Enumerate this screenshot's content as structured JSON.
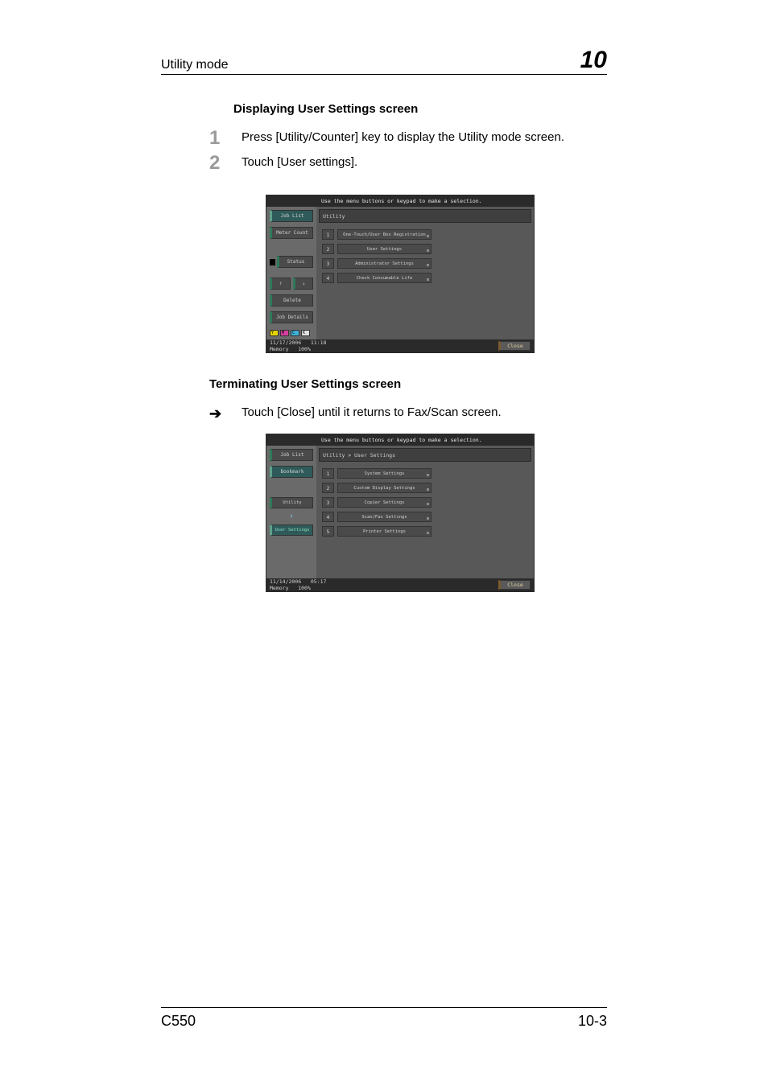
{
  "header": {
    "title": "Utility mode",
    "chapter": "10"
  },
  "sec1": {
    "heading": "Displaying User Settings screen",
    "steps": [
      "Press [Utility/Counter] key to display the Utility mode screen.",
      "Touch [User settings]."
    ]
  },
  "sec2": {
    "heading": "Terminating User Settings screen",
    "arrow_text": "Touch [Close] until it returns to Fax/Scan screen."
  },
  "shot1": {
    "top": "Use the menu buttons or keypad to make a selection.",
    "side": {
      "job_list": "Job List",
      "meter_count": "Meter Count",
      "status_lbl": "Status",
      "delete": "Delete",
      "job_details": "Job Details",
      "arrow_up": "↑",
      "arrow_down": "↓"
    },
    "crumb": "Utility",
    "menu": [
      {
        "n": "1",
        "label": "One-Touch/User Box\nRegistration"
      },
      {
        "n": "2",
        "label": "User Settings"
      },
      {
        "n": "3",
        "label": "Administrator Settings"
      },
      {
        "n": "4",
        "label": "Check Consumable Life"
      }
    ],
    "foot": {
      "date": "11/17/2006",
      "time": "11:18",
      "mem_lbl": "Memory",
      "mem_val": "100%",
      "close": "Close"
    },
    "toner": {
      "y": "Y",
      "m": "M",
      "c": "C",
      "k": "K"
    }
  },
  "shot2": {
    "top": "Use the menu buttons or keypad to make a selection.",
    "side": {
      "job_list": "Job List",
      "bookmark": "Bookmark",
      "utility": "Utility",
      "user_settings": "User Settings",
      "arrow_down": "⬇"
    },
    "crumb": "Utility > User Settings",
    "menu": [
      {
        "n": "1",
        "label": "System Settings"
      },
      {
        "n": "2",
        "label": "Custom Display Settings"
      },
      {
        "n": "3",
        "label": "Copier Settings"
      },
      {
        "n": "4",
        "label": "Scan/Fax Settings"
      },
      {
        "n": "5",
        "label": "Printer Settings"
      }
    ],
    "foot": {
      "date": "11/14/2006",
      "time": "05:17",
      "mem_lbl": "Memory",
      "mem_val": "100%",
      "close": "Close"
    }
  },
  "footer": {
    "left": "C550",
    "right": "10-3"
  }
}
